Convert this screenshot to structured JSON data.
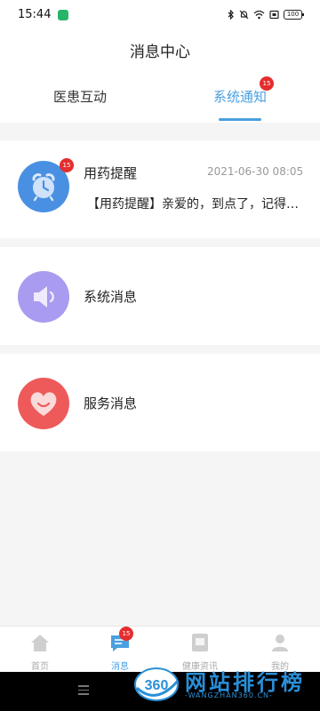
{
  "status_bar": {
    "time": "15:44",
    "battery": "100"
  },
  "header": {
    "title": "消息中心",
    "tabs": [
      {
        "label": "医患互动"
      },
      {
        "label": "系统通知",
        "badge": "15"
      }
    ]
  },
  "messages": [
    {
      "title": "用药提醒",
      "time": "2021-06-30 08:05",
      "preview": "【用药提醒】亲爱的，到点了，记得按时用药哦",
      "badge": "15",
      "icon": "alarm-clock-icon",
      "color": "#4a90e2"
    },
    {
      "title": "系统消息",
      "icon": "speaker-icon",
      "color": "#a99bf0"
    },
    {
      "title": "服务消息",
      "icon": "heart-icon",
      "color": "#ee5a5a"
    }
  ],
  "bottom_nav": [
    {
      "label": "首页",
      "icon": "home-icon"
    },
    {
      "label": "消息",
      "icon": "message-icon",
      "badge": "15"
    },
    {
      "label": "健康资讯",
      "icon": "news-icon"
    },
    {
      "label": "我的",
      "icon": "profile-icon"
    }
  ],
  "watermark": {
    "logo": "360",
    "title": "网站排行榜",
    "subtitle": "-WANGZHAN360.CN-"
  },
  "colors": {
    "accent": "#4a9fe0",
    "badge": "#e52d2d"
  }
}
